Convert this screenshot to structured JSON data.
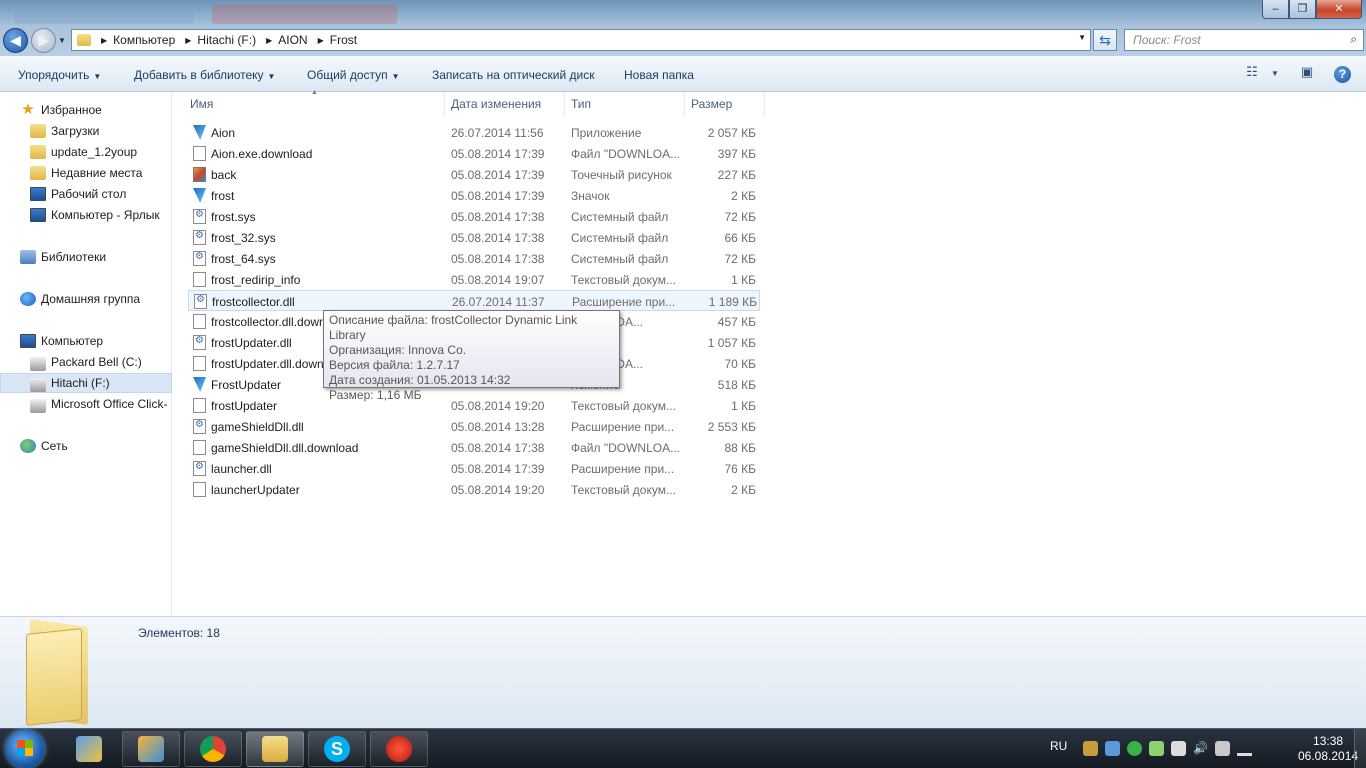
{
  "window": {
    "minimize_glyph": "–",
    "maximize_glyph": "❐",
    "close_glyph": "✕"
  },
  "address": {
    "crumbs": [
      "Компьютер",
      "Hitachi (F:)",
      "AION",
      "Frost"
    ],
    "search_placeholder": "Поиск: Frost"
  },
  "toolbar": {
    "organize": "Упорядочить",
    "add_to_library": "Добавить в библиотеку",
    "share": "Общий доступ",
    "burn": "Записать на оптический диск",
    "new_folder": "Новая папка"
  },
  "sidebar": {
    "items": [
      {
        "label": "Избранное",
        "icon": "star-icon"
      },
      {
        "label": "Загрузки",
        "icon": "downloads-folder-icon"
      },
      {
        "label": "update_1.2youp",
        "icon": "folder-icon"
      },
      {
        "label": "Недавние места",
        "icon": "recent-places-icon"
      },
      {
        "label": "Рабочий стол",
        "icon": "desktop-icon"
      },
      {
        "label": "Компьютер - Ярлык",
        "icon": "computer-shortcut-icon"
      },
      {
        "label": "Библиотеки",
        "icon": "libraries-icon"
      },
      {
        "label": "Домашняя группа",
        "icon": "homegroup-icon"
      },
      {
        "label": "Компьютер",
        "icon": "computer-icon"
      },
      {
        "label": "Packard Bell (C:)",
        "icon": "drive-icon"
      },
      {
        "label": "Hitachi (F:)",
        "icon": "drive-icon"
      },
      {
        "label": "Microsoft Office Click-",
        "icon": "drive-icon"
      },
      {
        "label": "Сеть",
        "icon": "network-icon"
      }
    ]
  },
  "columns": {
    "name": "Имя",
    "date": "Дата изменения",
    "type": "Тип",
    "size": "Размер"
  },
  "files": [
    {
      "name": "Aion",
      "date": "26.07.2014 11:56",
      "type": "Приложение",
      "size": "2 057 КБ",
      "icon": "app-icon"
    },
    {
      "name": "Aion.exe.download",
      "date": "05.08.2014 17:39",
      "type": "Файл \"DOWNLOA...",
      "size": "397 КБ",
      "icon": "file-icon"
    },
    {
      "name": "back",
      "date": "05.08.2014 17:39",
      "type": "Точечный рисунок",
      "size": "227 КБ",
      "icon": "bitmap-icon"
    },
    {
      "name": "frost",
      "date": "05.08.2014 17:39",
      "type": "Значок",
      "size": "2 КБ",
      "icon": "app-icon"
    },
    {
      "name": "frost.sys",
      "date": "05.08.2014 17:38",
      "type": "Системный файл",
      "size": "72 КБ",
      "icon": "system-file-icon"
    },
    {
      "name": "frost_32.sys",
      "date": "05.08.2014 17:38",
      "type": "Системный файл",
      "size": "66 КБ",
      "icon": "system-file-icon"
    },
    {
      "name": "frost_64.sys",
      "date": "05.08.2014 17:38",
      "type": "Системный файл",
      "size": "72 КБ",
      "icon": "system-file-icon"
    },
    {
      "name": "frost_redirip_info",
      "date": "05.08.2014 19:07",
      "type": "Текстовый докум...",
      "size": "1 КБ",
      "icon": "file-icon"
    },
    {
      "name": "frostcollector.dll",
      "date": "26.07.2014 11:37",
      "type": "Расширение при...",
      "size": "1 189 КБ",
      "icon": "system-file-icon"
    },
    {
      "name": "frostcollector.dll.download",
      "date": "",
      "type": "DOWNLOA...",
      "size": "457 КБ",
      "icon": "file-icon"
    },
    {
      "name": "frostUpdater.dll",
      "date": "",
      "type": "",
      "size": "1 057 КБ",
      "icon": "system-file-icon"
    },
    {
      "name": "frostUpdater.dll.download",
      "date": "",
      "type": "DOWNLOA...",
      "size": "70 КБ",
      "icon": "file-icon"
    },
    {
      "name": "FrostUpdater",
      "date": "",
      "type": "ложение",
      "size": "518 КБ",
      "icon": "app-icon"
    },
    {
      "name": "frostUpdater",
      "date": "05.08.2014 19:20",
      "type": "Текстовый докум...",
      "size": "1 КБ",
      "icon": "file-icon"
    },
    {
      "name": "gameShieldDll.dll",
      "date": "05.08.2014 13:28",
      "type": "Расширение при...",
      "size": "2 553 КБ",
      "icon": "system-file-icon"
    },
    {
      "name": "gameShieldDll.dll.download",
      "date": "05.08.2014 17:38",
      "type": "Файл \"DOWNLOA...",
      "size": "88 КБ",
      "icon": "file-icon"
    },
    {
      "name": "launcher.dll",
      "date": "05.08.2014 17:39",
      "type": "Расширение при...",
      "size": "76 КБ",
      "icon": "system-file-icon"
    },
    {
      "name": "launcherUpdater",
      "date": "05.08.2014 19:20",
      "type": "Текстовый докум...",
      "size": "2 КБ",
      "icon": "file-icon"
    }
  ],
  "tooltip": {
    "lines": [
      "Описание файла: frostCollector Dynamic Link Library",
      "Организация: Innova Co.",
      "Версия файла: 1.2.7.17",
      "Дата создания: 01.05.2013 14:32",
      "Размер: 1,16 МБ"
    ]
  },
  "details": {
    "count": "Элементов: 18"
  },
  "taskbar": {
    "language": "RU",
    "time": "13:38",
    "date": "06.08.2014"
  }
}
